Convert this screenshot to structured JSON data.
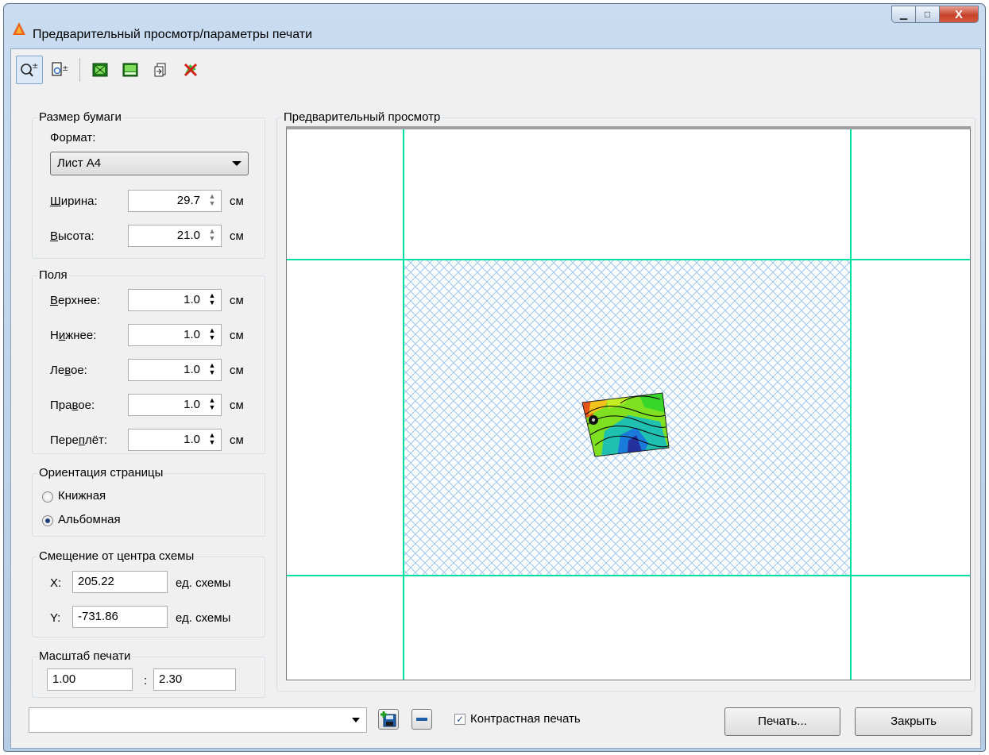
{
  "window": {
    "title": "Предварительный просмотр/параметры печати",
    "accent": "#c6412b"
  },
  "toolbar": {
    "buttons": [
      "zoom-in-out-icon",
      "page-zoom-icon",
      "fit-page-icon",
      "grid-layout-icon",
      "page-arrow-icon",
      "remove-area-icon"
    ]
  },
  "paper": {
    "group_label": "Размер бумаги",
    "format_label": "Формат:",
    "format_value": "Лист А4",
    "width_label": "Ширина:",
    "width_value": "29.7",
    "height_label": "Высота:",
    "height_value": "21.0",
    "unit": "см"
  },
  "margins": {
    "group_label": "Поля",
    "unit": "см",
    "items": [
      {
        "label": "Верхнее:",
        "value": "1.0"
      },
      {
        "label": "Нижнее:",
        "value": "1.0"
      },
      {
        "label": "Левое:",
        "value": "1.0"
      },
      {
        "label": "Правое:",
        "value": "1.0"
      },
      {
        "label": "Переплёт:",
        "value": "1.0"
      }
    ]
  },
  "orientation": {
    "group_label": "Ориентация страницы",
    "portrait": "Книжная",
    "landscape": "Альбомная",
    "selected": "landscape"
  },
  "offset": {
    "group_label": "Смещение от центра схемы",
    "x_label": "X:",
    "x_value": "205.22",
    "y_label": "Y:",
    "y_value": "-731.86",
    "unit": "ед. схемы"
  },
  "scale": {
    "group_label": "Масштаб печати",
    "left": "1.00",
    "sep": ":",
    "right": "2.30"
  },
  "preview": {
    "group_label": "Предварительный просмотр",
    "grid_color": "#00e0a0",
    "hatch_color": "#9ec4f0"
  },
  "bottom": {
    "combo_value": "",
    "contrast_label": "Контрастная печать",
    "contrast_checked": true,
    "print_button": "Печать...",
    "close_button": "Закрыть"
  }
}
